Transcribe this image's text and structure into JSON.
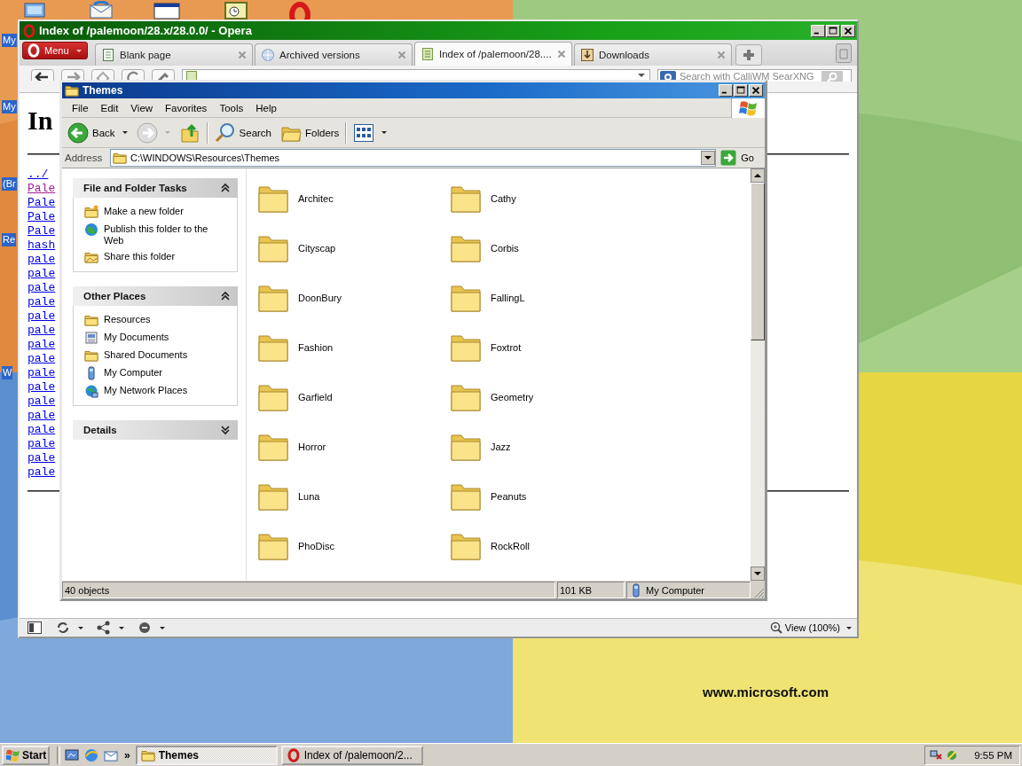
{
  "desktop": {
    "side_labels": [
      "My",
      "My",
      "(Br",
      "Re",
      "W"
    ],
    "wallpaper_text": "www.microsoft.com"
  },
  "browser": {
    "title": "Index of /palemoon/28.x/28.0.0/ - Opera",
    "menu_button": "Menu",
    "tabs": [
      {
        "label": "Blank page",
        "kind": "page",
        "selected": false
      },
      {
        "label": "Archived versions",
        "kind": "globe",
        "selected": false
      },
      {
        "label": "Index of /palemoon/28....",
        "kind": "listing",
        "selected": true
      },
      {
        "label": "Downloads",
        "kind": "download",
        "selected": false
      }
    ],
    "search": {
      "placeholder": "Search with CalliWM SearXNG"
    },
    "page": {
      "heading": "In",
      "links": [
        {
          "text": "../",
          "visited": false
        },
        {
          "text": "Pale",
          "visited": true
        },
        {
          "text": "Pale",
          "visited": false
        },
        {
          "text": "Pale",
          "visited": false
        },
        {
          "text": "Pale",
          "visited": false
        },
        {
          "text": "hash",
          "visited": false
        },
        {
          "text": "pale",
          "visited": false
        },
        {
          "text": "pale",
          "visited": false
        },
        {
          "text": "pale",
          "visited": false
        },
        {
          "text": "pale",
          "visited": false
        },
        {
          "text": "pale",
          "visited": false
        },
        {
          "text": "pale",
          "visited": false
        },
        {
          "text": "pale",
          "visited": false
        },
        {
          "text": "pale",
          "visited": false
        },
        {
          "text": "pale",
          "visited": false
        },
        {
          "text": "pale",
          "visited": false
        },
        {
          "text": "pale",
          "visited": false
        },
        {
          "text": "pale",
          "visited": false
        },
        {
          "text": "pale",
          "visited": false
        },
        {
          "text": "pale",
          "visited": false
        },
        {
          "text": "pale",
          "visited": false
        },
        {
          "text": "pale",
          "visited": false
        }
      ]
    },
    "status_bar": {
      "zoom": "View (100%)"
    }
  },
  "explorer": {
    "title": "Themes",
    "menu": [
      "File",
      "Edit",
      "View",
      "Favorites",
      "Tools",
      "Help"
    ],
    "toolbar": {
      "back": "Back",
      "search": "Search",
      "folders": "Folders"
    },
    "address": {
      "label": "Address",
      "value": "C:\\WINDOWS\\Resources\\Themes",
      "go": "Go"
    },
    "panels": [
      {
        "title": "File and Folder Tasks",
        "expanded": true,
        "items": [
          {
            "label": "Make a new folder",
            "kind": "new-folder"
          },
          {
            "label": "Publish this folder to the Web",
            "kind": "publish"
          },
          {
            "label": "Share this folder",
            "kind": "share"
          }
        ]
      },
      {
        "title": "Other Places",
        "expanded": true,
        "items": [
          {
            "label": "Resources",
            "kind": "folder"
          },
          {
            "label": "My Documents",
            "kind": "documents"
          },
          {
            "label": "Shared Documents",
            "kind": "folder"
          },
          {
            "label": "My Computer",
            "kind": "computer"
          },
          {
            "label": "My Network Places",
            "kind": "network"
          }
        ]
      },
      {
        "title": "Details",
        "expanded": false
      }
    ],
    "folders": [
      "Architec",
      "Cathy",
      "Cityscap",
      "Corbis",
      "DoonBury",
      "FallingL",
      "Fashion",
      "Foxtrot",
      "Garfield",
      "Geometry",
      "Horror",
      "Jazz",
      "Luna",
      "Peanuts",
      "PhoDisc",
      "RockRoll"
    ],
    "status_bar": {
      "objects": "40 objects",
      "size": "101 KB",
      "zone": "My Computer"
    }
  },
  "taskbar": {
    "start": "Start",
    "more": "»",
    "tasks": [
      {
        "label": "Themes",
        "kind": "folder",
        "selected": true
      },
      {
        "label": "Index of /palemoon/2...",
        "kind": "opera",
        "selected": false
      }
    ],
    "clock": "9:55 PM"
  }
}
